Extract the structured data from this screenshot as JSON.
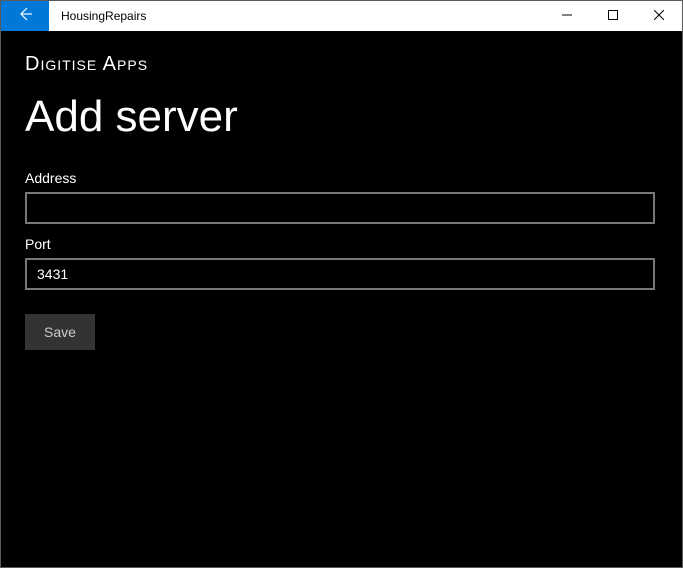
{
  "titlebar": {
    "title": "HousingRepairs"
  },
  "content": {
    "brand": "Digitise Apps",
    "page_title": "Add server",
    "address": {
      "label": "Address",
      "value": ""
    },
    "port": {
      "label": "Port",
      "value": "3431"
    },
    "save_label": "Save"
  }
}
